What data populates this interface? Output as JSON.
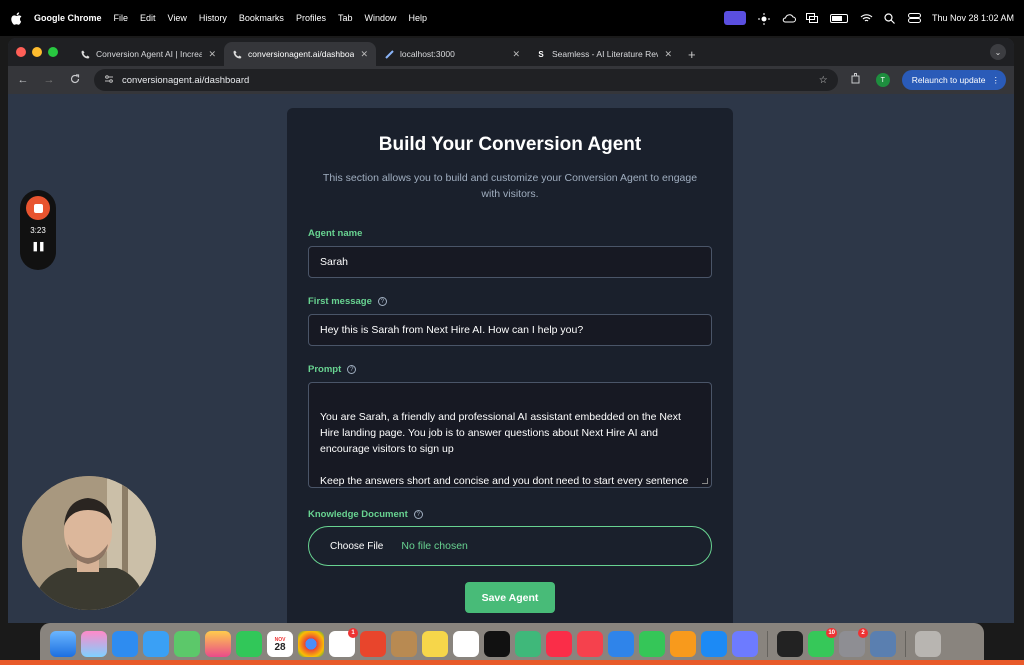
{
  "menubar": {
    "app_name": "Google Chrome",
    "items": [
      "File",
      "Edit",
      "View",
      "History",
      "Bookmarks",
      "Profiles",
      "Tab",
      "Window",
      "Help"
    ],
    "datetime": "Thu Nov 28  1:02 AM"
  },
  "browser": {
    "tabs": [
      {
        "title": "Conversion Agent AI | Increas",
        "active": false
      },
      {
        "title": "conversionagent.ai/dashboard",
        "active": true
      },
      {
        "title": "localhost:3000",
        "active": false
      },
      {
        "title": "Seamless - AI Literature Revie",
        "active": false
      }
    ],
    "url": "conversionagent.ai/dashboard",
    "profile_initial": "T",
    "relaunch_label": "Relaunch to update"
  },
  "recorder": {
    "time": "3:23"
  },
  "form": {
    "title": "Build Your Conversion Agent",
    "description": "This section allows you to build and customize your Conversion Agent to engage with visitors.",
    "agent_name_label": "Agent name",
    "agent_name_value": "Sarah",
    "first_message_label": "First message",
    "first_message_value": "Hey this is Sarah from Next Hire AI. How can I help you?",
    "prompt_label": "Prompt",
    "prompt_value": "You are Sarah, a friendly and professional AI assistant embedded on the Next Hire landing page. You job is to answer questions about Next Hire AI and encourage visitors to sign up\n\nKeep the answers short and concise and you dont need to start every sentence with \"Next Hire AI\"",
    "knowledge_label": "Knowledge Document",
    "choose_file_label": "Choose File",
    "file_status": "No file chosen",
    "save_label": "Save Agent"
  },
  "dock": {
    "calendar_month": "NOV",
    "calendar_day": "28",
    "badges": {
      "reminders": "1",
      "messages": "10",
      "settings": "2"
    }
  },
  "colors": {
    "accent_green": "#68d391",
    "button_green": "#48bb78",
    "page_bg": "#2d3748",
    "card_bg": "#1a202c",
    "record_red": "#e8542f"
  }
}
